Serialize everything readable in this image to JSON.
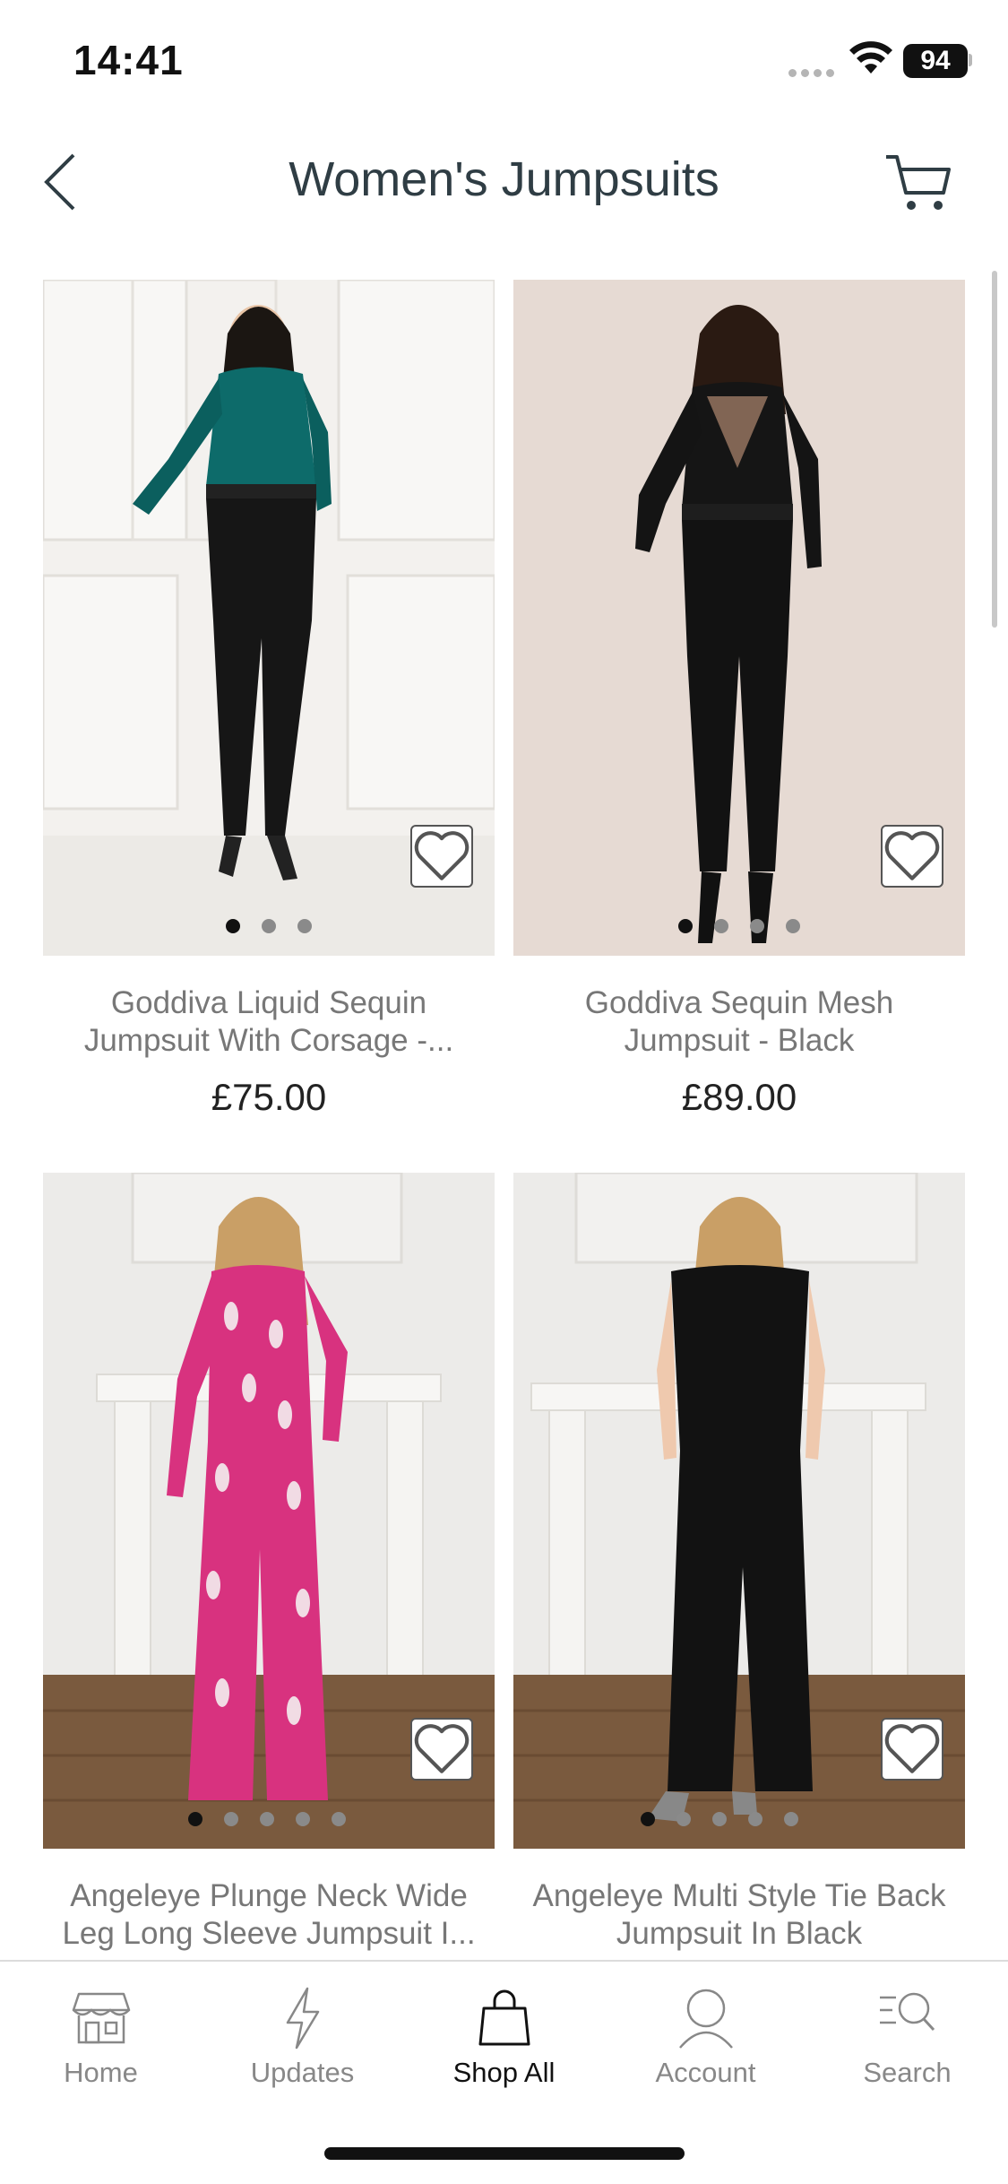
{
  "status": {
    "time": "14:41",
    "battery": "94"
  },
  "header": {
    "title": "Women's Jumpsuits",
    "back_icon": "chevron-left-icon",
    "cart_icon": "cart-icon"
  },
  "products": [
    {
      "name_line1": "Goddiva Liquid Sequin",
      "name_line2": "Jumpsuit With Corsage -...",
      "price": "£75.00",
      "image_dots": 3,
      "active_dot": 0
    },
    {
      "name_line1": "Goddiva Sequin Mesh",
      "name_line2": "Jumpsuit - Black",
      "price": "£89.00",
      "image_dots": 4,
      "active_dot": 0
    },
    {
      "name_line1": "Angeleye Plunge Neck Wide",
      "name_line2": "Leg Long Sleeve Jumpsuit I...",
      "price": "",
      "image_dots": 5,
      "active_dot": 0
    },
    {
      "name_line1": "Angeleye Multi Style Tie Back",
      "name_line2": "Jumpsuit In Black",
      "price": "",
      "image_dots": 5,
      "active_dot": 0
    }
  ],
  "tabs": [
    {
      "label": "Home",
      "icon": "store-icon"
    },
    {
      "label": "Updates",
      "icon": "lightning-icon"
    },
    {
      "label": "Shop All",
      "icon": "shopping-bag-icon",
      "active": true
    },
    {
      "label": "Account",
      "icon": "user-icon"
    },
    {
      "label": "Search",
      "icon": "search-icon"
    }
  ],
  "colors": {
    "text_dark": "#2f3d44",
    "text_muted": "#777777",
    "active_tab": "#111111",
    "inactive_tab": "#888888"
  }
}
